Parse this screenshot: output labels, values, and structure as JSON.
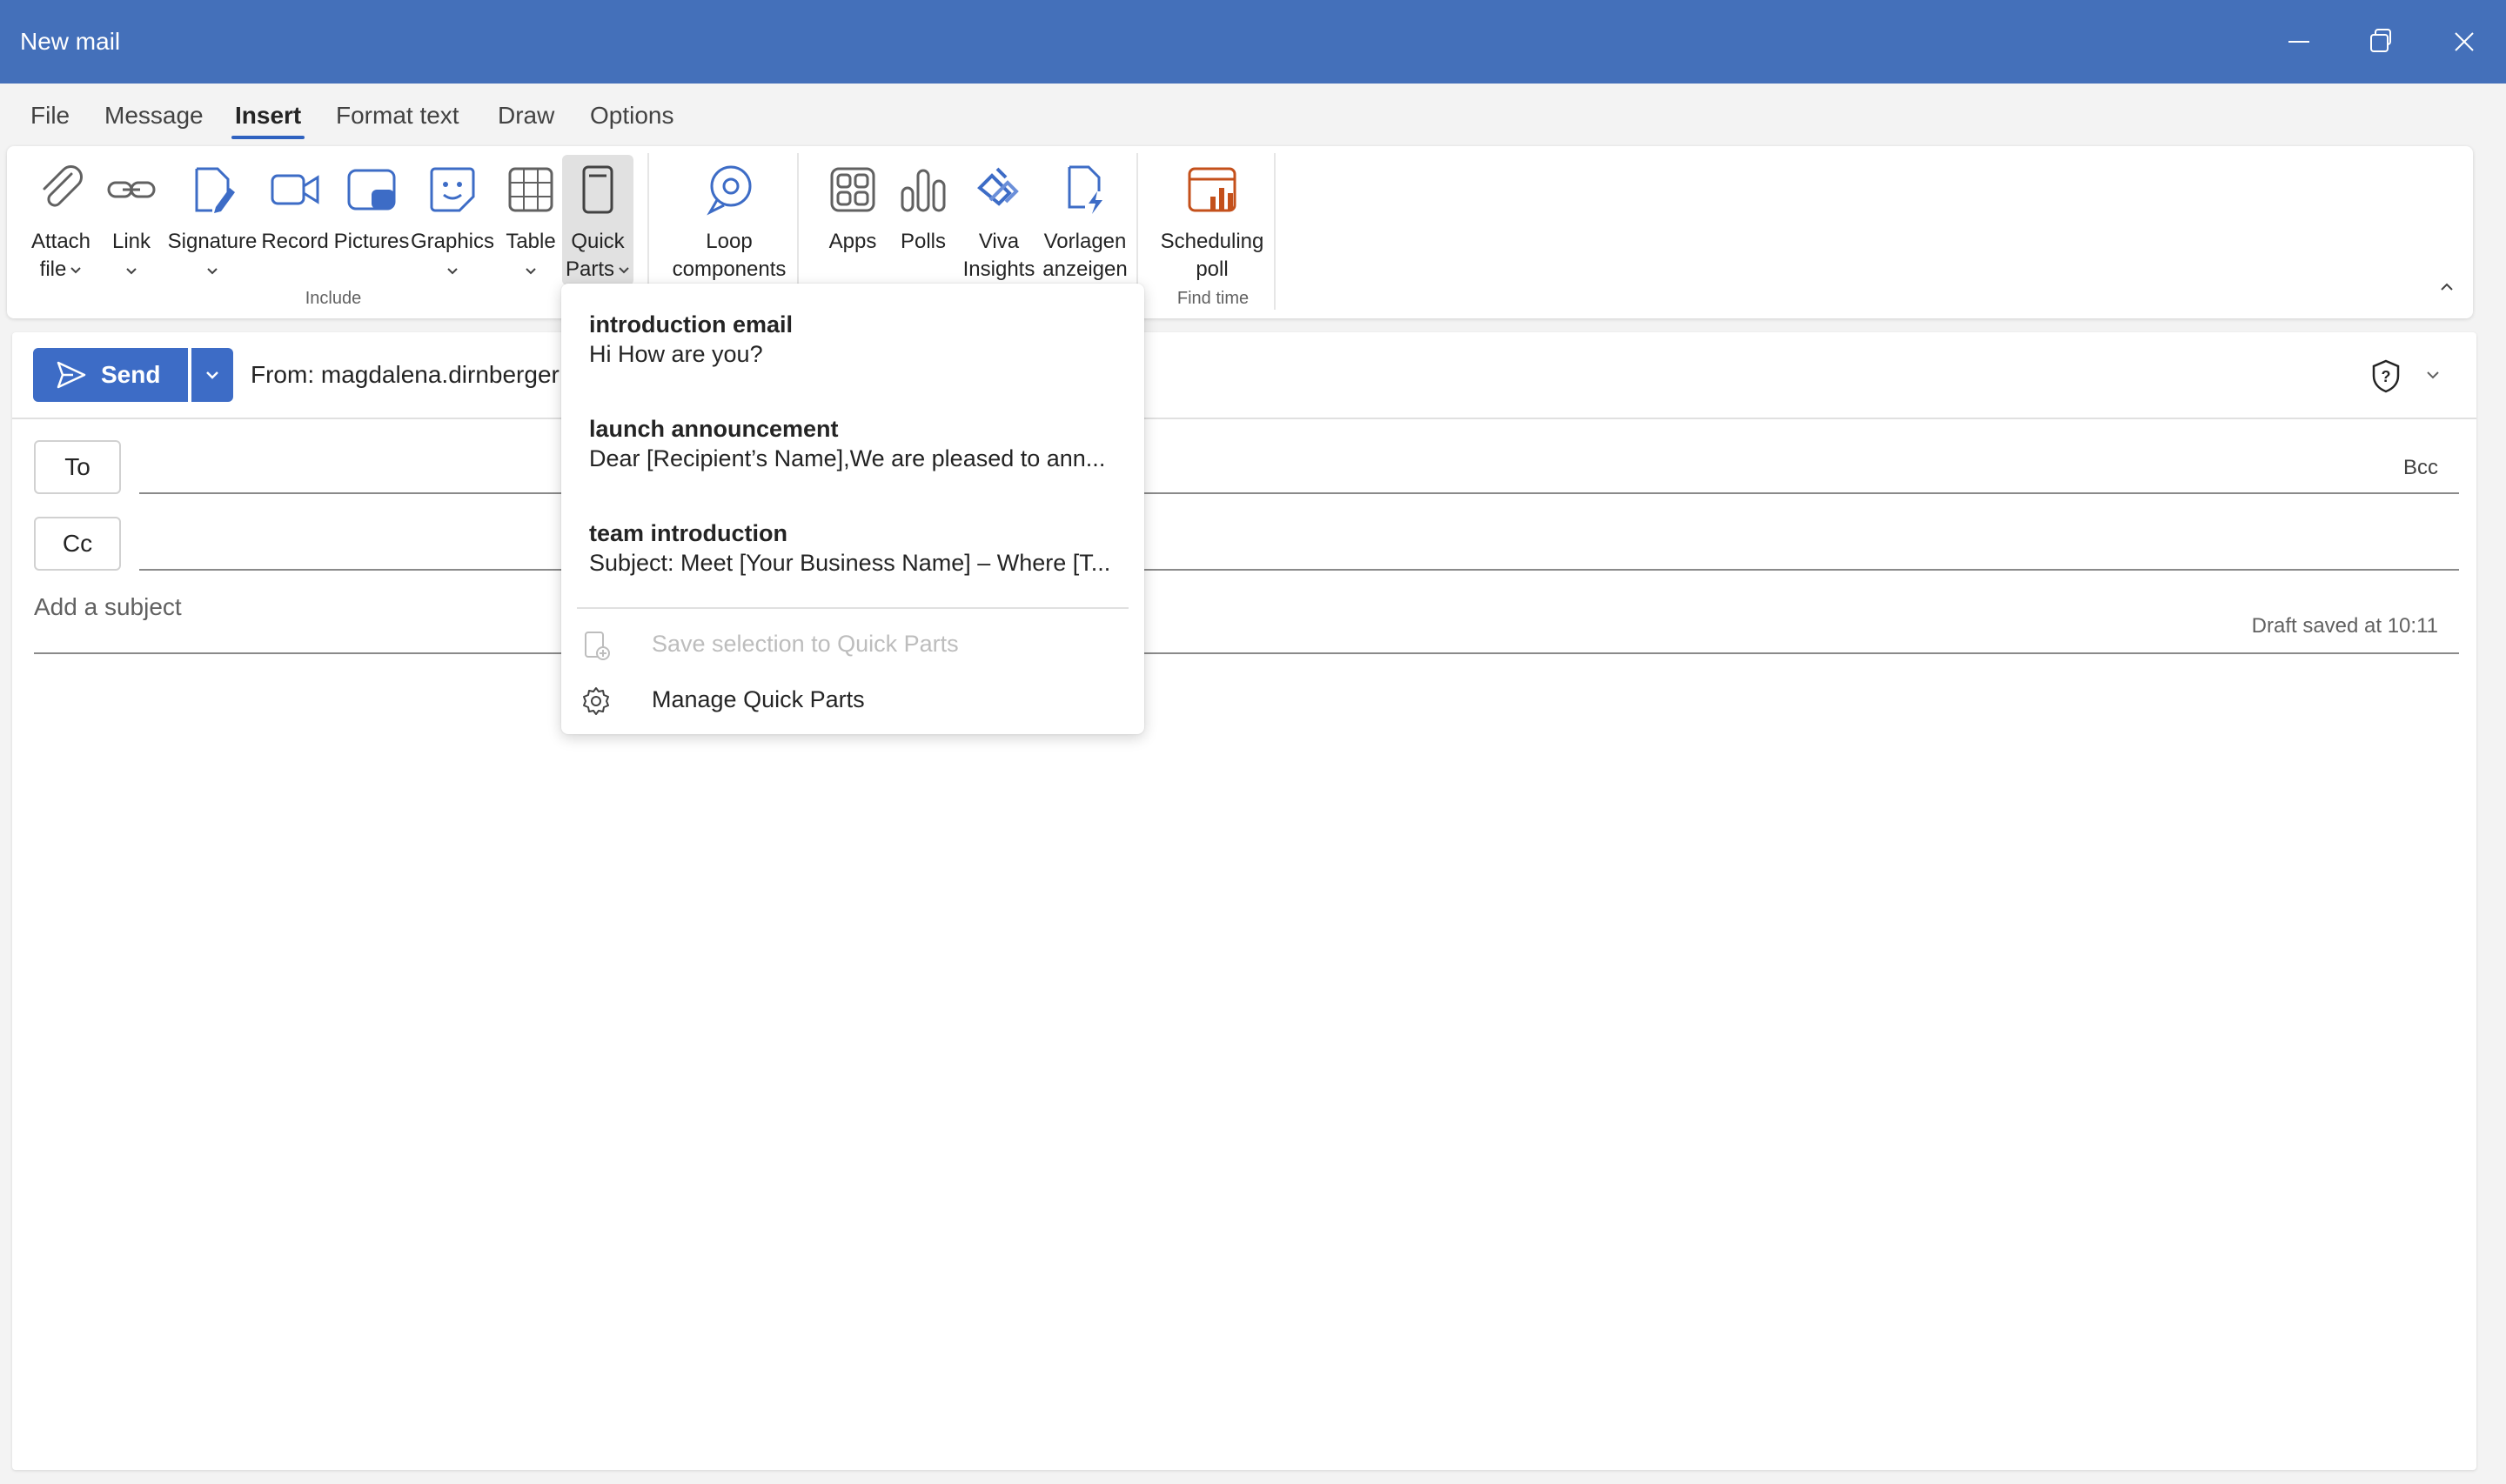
{
  "window": {
    "title": "New mail"
  },
  "tabs": [
    {
      "label": "File"
    },
    {
      "label": "Message"
    },
    {
      "label": "Insert"
    },
    {
      "label": "Format text"
    },
    {
      "label": "Draw"
    },
    {
      "label": "Options"
    }
  ],
  "active_tab": "Insert",
  "ribbon": {
    "attach": {
      "line1": "Attach",
      "line2": "file"
    },
    "link": {
      "label": "Link"
    },
    "signature": {
      "label": "Signature"
    },
    "record": {
      "label": "Record"
    },
    "pictures": {
      "label": "Pictures"
    },
    "graphics": {
      "label": "Graphics"
    },
    "table": {
      "label": "Table"
    },
    "quick_parts": {
      "line1": "Quick",
      "line2": "Parts"
    },
    "loop": {
      "line1": "Loop",
      "line2": "components"
    },
    "apps": {
      "label": "Apps"
    },
    "polls": {
      "label": "Polls"
    },
    "viva": {
      "line1": "Viva",
      "line2": "Insights"
    },
    "vorlagen": {
      "line1": "Vorlagen",
      "line2": "anzeigen"
    },
    "scheduling": {
      "line1": "Scheduling",
      "line2": "poll"
    },
    "groups": {
      "include": "Include",
      "find_time": "Find time"
    }
  },
  "compose": {
    "send_label": "Send",
    "from_label": "From: magdalena.dirnberger",
    "to_label": "To",
    "cc_label": "Cc",
    "bcc_label": "Bcc",
    "subject_placeholder": "Add a subject",
    "draft_status": "Draft saved at 10:11"
  },
  "quick_parts_menu": {
    "items": [
      {
        "title": "introduction email",
        "preview": "Hi How are you?"
      },
      {
        "title": "launch announcement",
        "preview": "Dear [Recipient’s Name],We are pleased to ann..."
      },
      {
        "title": "team introduction",
        "preview": "Subject: Meet [Your Business Name] – Where [T..."
      }
    ],
    "save_selection": "Save selection to Quick Parts",
    "manage": "Manage Quick Parts"
  },
  "colors": {
    "titlebar": "#4470ba",
    "accent": "#3d6cc6",
    "scheduling_icon": "#c4501b"
  }
}
